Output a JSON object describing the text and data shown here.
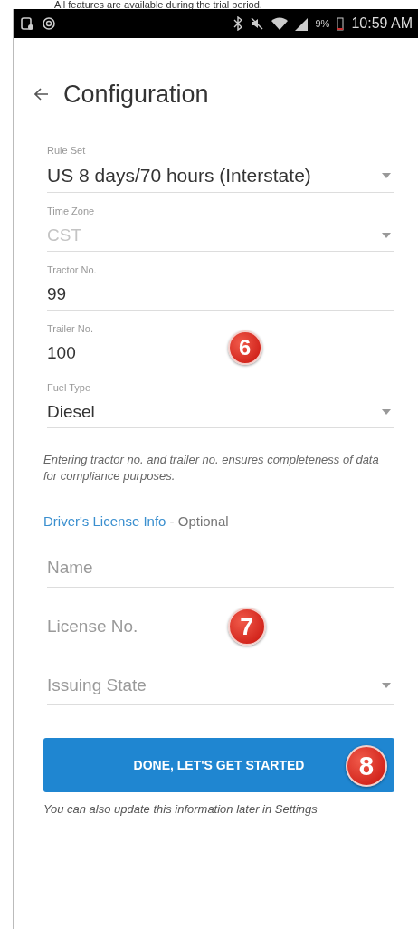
{
  "banner": "All features are available during the trial period.",
  "status_bar": {
    "battery": "9%",
    "time": "10:59 AM"
  },
  "header": {
    "title": "Configuration"
  },
  "fields": [
    {
      "kind": "select",
      "label": "Rule Set",
      "value": "US 8 days/70 hours (Interstate)",
      "disabled": false
    },
    {
      "kind": "select",
      "label": "Time Zone",
      "value": "CST",
      "disabled": true
    },
    {
      "kind": "text",
      "label": "Tractor No.",
      "value": "99",
      "disabled": false
    },
    {
      "kind": "text",
      "label": "Trailer No.",
      "value": "100",
      "disabled": false,
      "marker": "6"
    },
    {
      "kind": "select",
      "label": "Fuel Type",
      "value": "Diesel",
      "disabled": false
    }
  ],
  "note": "Entering tractor no. and trailer no. ensures completeness of data for compliance purposes.",
  "license_section": {
    "title": "Driver's License Info",
    "suffix": "- Optional"
  },
  "license_fields": [
    {
      "kind": "text",
      "placeholder": "Name"
    },
    {
      "kind": "text",
      "placeholder": "License No.",
      "marker": "7"
    },
    {
      "kind": "select",
      "placeholder": "Issuing State"
    }
  ],
  "button": {
    "label": "DONE, LET'S GET STARTED",
    "marker": "8"
  },
  "footer_note": "You can also update this information later in Settings"
}
